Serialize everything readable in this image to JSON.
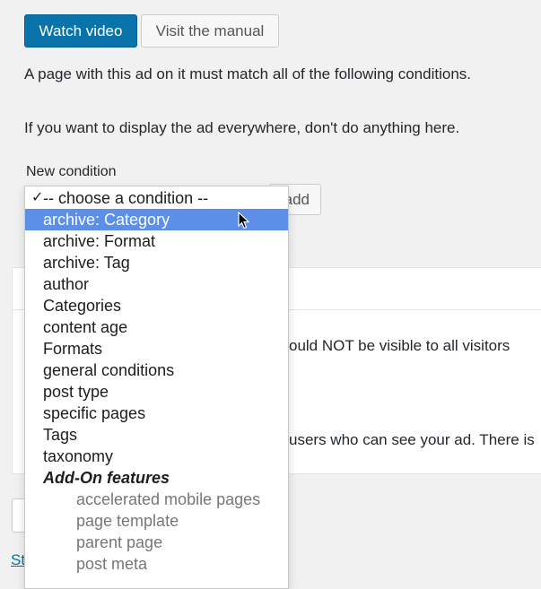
{
  "buttons": {
    "watch_video": "Watch video",
    "visit_manual": "Visit the manual",
    "add_partial": "add"
  },
  "intro": {
    "conditions_text": "A page with this ad on it must match all of the following conditions.",
    "everywhere_text": "If you want to display the ad everywhere, don't do anything here."
  },
  "new_condition_label": "New condition",
  "visitor_fragment_1": "ould NOT be visible to all visitors",
  "visitor_fragment_2": "users who can see your ad. There is",
  "bottom_link_fragment": "St",
  "dropdown": {
    "selected": "-- choose a condition --",
    "options": [
      {
        "label": "archive: Category",
        "highlight": true
      },
      {
        "label": "archive: Format"
      },
      {
        "label": "archive: Tag"
      },
      {
        "label": "author"
      },
      {
        "label": "Categories"
      },
      {
        "label": "content age"
      },
      {
        "label": "Formats"
      },
      {
        "label": "general conditions"
      },
      {
        "label": "post type"
      },
      {
        "label": "specific pages"
      },
      {
        "label": "Tags"
      },
      {
        "label": "taxonomy"
      }
    ],
    "group_label": "Add-On features",
    "addon_options": [
      {
        "label": "accelerated mobile pages"
      },
      {
        "label": "page template"
      },
      {
        "label": "parent page"
      },
      {
        "label": "post meta"
      }
    ]
  },
  "colors": {
    "primary_button": "#0a73aa",
    "highlight": "#5b8fe8",
    "link": "#0073aa"
  }
}
